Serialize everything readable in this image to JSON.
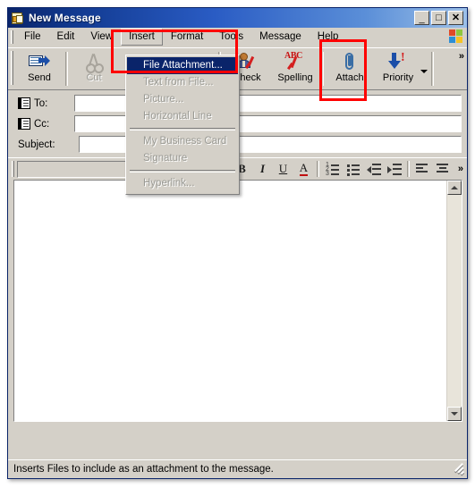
{
  "window": {
    "title": "New Message",
    "icon": "new-message-icon",
    "controls": {
      "minimize": "_",
      "maximize": "□",
      "close": "✕"
    }
  },
  "menubar": {
    "items": [
      {
        "label": "File",
        "state": "normal"
      },
      {
        "label": "Edit",
        "state": "normal"
      },
      {
        "label": "View",
        "state": "normal"
      },
      {
        "label": "Insert",
        "state": "open"
      },
      {
        "label": "Format",
        "state": "normal"
      },
      {
        "label": "Tools",
        "state": "normal"
      },
      {
        "label": "Message",
        "state": "normal"
      },
      {
        "label": "Help",
        "state": "normal"
      }
    ],
    "logo": "windows-logo-icon"
  },
  "toolbar": {
    "buttons": [
      {
        "label": "Send",
        "icon": "send-icon",
        "enabled": true
      },
      {
        "label": "Cut",
        "icon": "cut-icon",
        "enabled": false
      },
      {
        "label": "Check",
        "icon": "check-names-icon",
        "enabled": true
      },
      {
        "label": "Spelling",
        "icon": "spelling-icon",
        "enabled": true
      },
      {
        "label": "Attach",
        "icon": "paperclip-icon",
        "enabled": true
      },
      {
        "label": "Priority",
        "icon": "priority-icon",
        "enabled": true
      }
    ],
    "overflow_label": "»"
  },
  "dropdown": {
    "parent_menu": "Insert",
    "items": [
      {
        "label": "File Attachment...",
        "state": "highlighted"
      },
      {
        "label": "Text from File...",
        "state": "disabled"
      },
      {
        "label": "Picture...",
        "state": "disabled"
      },
      {
        "label": "Horizontal Line",
        "state": "disabled"
      },
      {
        "separator": true
      },
      {
        "label": "My Business Card",
        "state": "disabled"
      },
      {
        "label": "Signature",
        "state": "disabled"
      },
      {
        "separator": true
      },
      {
        "label": "Hyperlink...",
        "state": "disabled"
      }
    ]
  },
  "address_fields": [
    {
      "label": "To:",
      "value": "",
      "icon": "address-book-icon",
      "has_icon": true
    },
    {
      "label": "Cc:",
      "value": "",
      "icon": "address-book-icon",
      "has_icon": true
    },
    {
      "label": "Subject:",
      "value": "",
      "icon": "",
      "has_icon": false
    }
  ],
  "format_toolbar": {
    "font_name": "",
    "font_size": "",
    "buttons": [
      {
        "name": "paragraph-style",
        "glyph": "≡"
      },
      {
        "name": "bold",
        "glyph": "B"
      },
      {
        "name": "italic",
        "glyph": "I"
      },
      {
        "name": "underline",
        "glyph": "U"
      },
      {
        "name": "font-color",
        "glyph": "A"
      },
      {
        "name": "numbered-list",
        "glyph": ""
      },
      {
        "name": "bulleted-list",
        "glyph": ""
      },
      {
        "name": "decrease-indent",
        "glyph": ""
      },
      {
        "name": "increase-indent",
        "glyph": ""
      },
      {
        "name": "align-left",
        "glyph": ""
      },
      {
        "name": "align-center",
        "glyph": ""
      }
    ],
    "overflow_label": "»"
  },
  "body": {
    "text": ""
  },
  "statusbar": {
    "text": "Inserts Files to include as an attachment to the message."
  },
  "annotations": [
    {
      "name": "insert-menu-highlight",
      "color": "#ff0000"
    },
    {
      "name": "attach-button-highlight",
      "color": "#ff0000"
    }
  ]
}
